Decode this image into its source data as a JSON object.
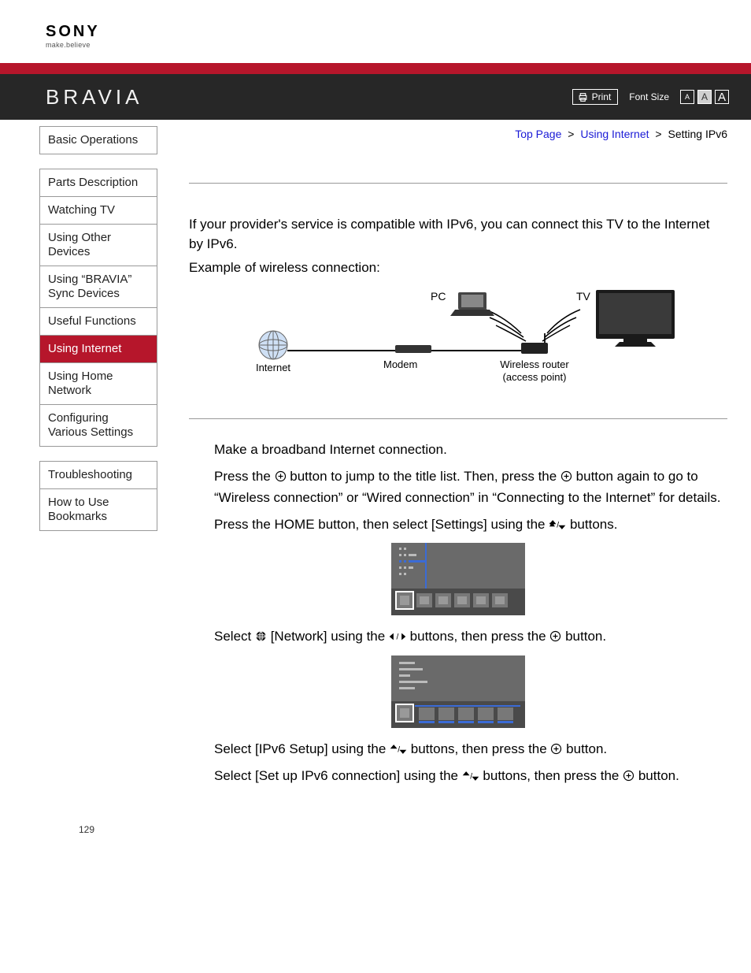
{
  "brand": {
    "logo": "SONY",
    "tagline": "make.believe",
    "product": "BRAVIA"
  },
  "toolbar": {
    "print": "Print",
    "font_size_label": "Font Size",
    "fs_small": "A",
    "fs_med": "A",
    "fs_large": "A"
  },
  "breadcrumb": {
    "top": "Top Page",
    "mid": "Using Internet",
    "current": "Setting IPv6",
    "sep": ">"
  },
  "sidebar": {
    "g1": {
      "i0": "Basic Operations"
    },
    "g2": {
      "i0": "Parts Description",
      "i1": "Watching TV",
      "i2": "Using Other Devices",
      "i3": "Using “BRAVIA” Sync Devices",
      "i4": "Useful Functions",
      "i5": "Using Internet",
      "i6": "Using Home Network",
      "i7": "Configuring Various Settings"
    },
    "g3": {
      "i0": "Troubleshooting",
      "i1": "How to Use Bookmarks"
    }
  },
  "content": {
    "intro1": "If your provider's service is compatible with IPv6, you can connect this TV to the Internet by IPv6.",
    "intro2": "Example of wireless connection:",
    "diagram": {
      "pc": "PC",
      "tv": "TV",
      "internet": "Internet",
      "modem": "Modem",
      "router": "Wireless router",
      "ap": "(access point)"
    },
    "step1": "Make a broadband Internet connection.",
    "step1b_a": "Press the ",
    "step1b_b": " button to jump to the title list. Then, press the ",
    "step1b_c": " button again to go to “Wireless connection” or “Wired connection” in “Connecting to the Internet” for details.",
    "step2_a": "Press the HOME button, then select [Settings] using the ",
    "step2_b": " buttons.",
    "step3_a": "Select ",
    "step3_b": " [Network] using the ",
    "step3_c": " buttons, then press the ",
    "step3_d": " button.",
    "step4_a": "Select [IPv6 Setup] using the ",
    "step4_b": " buttons, then press the ",
    "step4_c": " button.",
    "step5_a": "Select [Set up IPv6 connection] using the ",
    "step5_b": " buttons, then press the ",
    "step5_c": " button."
  },
  "page_number": "129"
}
